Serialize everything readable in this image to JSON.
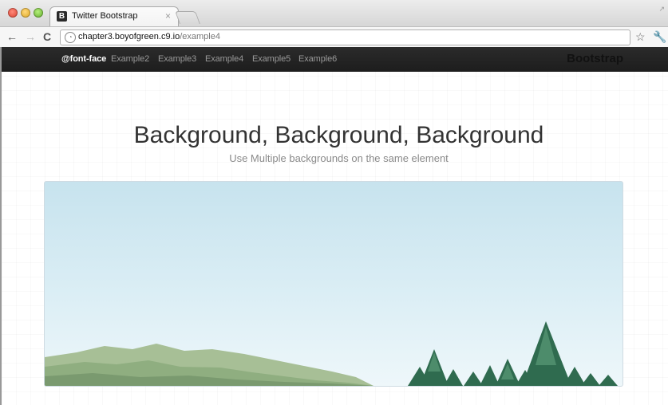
{
  "browser": {
    "tab_title": "Twitter Bootstrap",
    "tab_favicon": "B",
    "tab_close": "×",
    "url_host": "chapter3.boyofgreen.c9.io",
    "url_path": "/example4",
    "back_icon": "back-arrow-icon",
    "forward_icon": "forward-arrow-icon",
    "reload_icon": "reload-icon",
    "star_icon": "star-icon",
    "wrench_icon": "wrench-icon"
  },
  "navbar": {
    "items": [
      "@font-face",
      "Example2",
      "Example3",
      "Example4",
      "Example5",
      "Example6"
    ],
    "active_index": 0,
    "brand": "Bootstrap"
  },
  "main": {
    "headline": "Background, Background, Background",
    "subhead": "Use Multiple backgrounds on the same element"
  },
  "colors": {
    "navbar_bg": "#222222",
    "sky_top": "#c7e3ee",
    "mountain": "#9fb98f",
    "tree": "#2f6b4f"
  }
}
